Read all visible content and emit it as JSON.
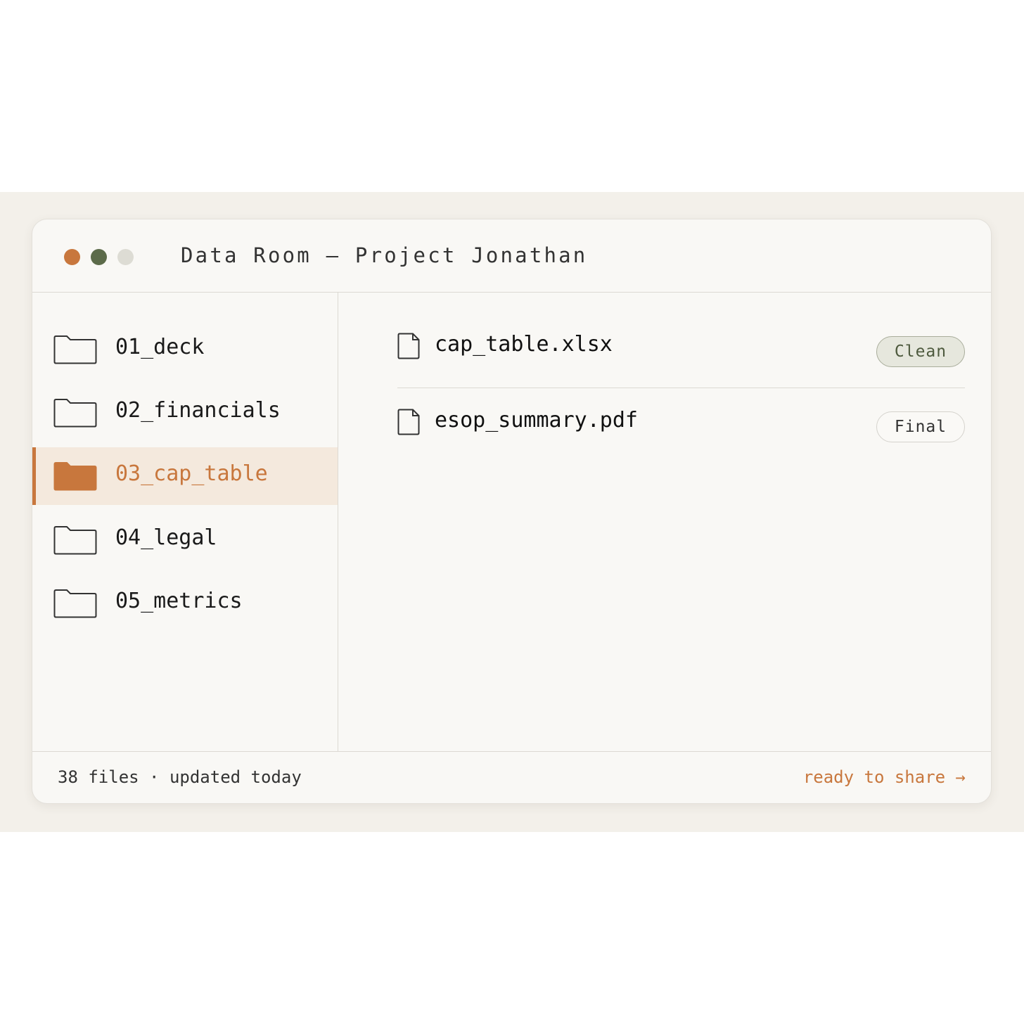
{
  "window": {
    "title": "Data Room — Project Jonathan",
    "controls": [
      "close",
      "minimize",
      "maximize"
    ]
  },
  "sidebar": {
    "folders": [
      {
        "label": "01_deck",
        "icon": "folder-icon",
        "active": false
      },
      {
        "label": "02_financials",
        "icon": "folder-icon",
        "active": false
      },
      {
        "label": "03_cap_table",
        "icon": "folder-icon",
        "active": true
      },
      {
        "label": "04_legal",
        "icon": "folder-icon",
        "active": false
      },
      {
        "label": "05_metrics",
        "icon": "folder-icon",
        "active": false
      }
    ]
  },
  "files": [
    {
      "name": "cap_table.xlsx",
      "icon": "file-icon",
      "status": "Clean"
    },
    {
      "name": "esop_summary.pdf",
      "icon": "file-icon",
      "status": "Final"
    }
  ],
  "status_bar": {
    "summary": "38 files · updated today",
    "action": "ready to share →"
  },
  "colors": {
    "accent": "#c8773d",
    "green_dot": "#5c6b4a",
    "gray_dot": "#dddcd4",
    "window_bg": "#f9f8f5",
    "active_row_bg": "#f4e9dd",
    "clean_badge_bg": "#e6e7dd"
  }
}
